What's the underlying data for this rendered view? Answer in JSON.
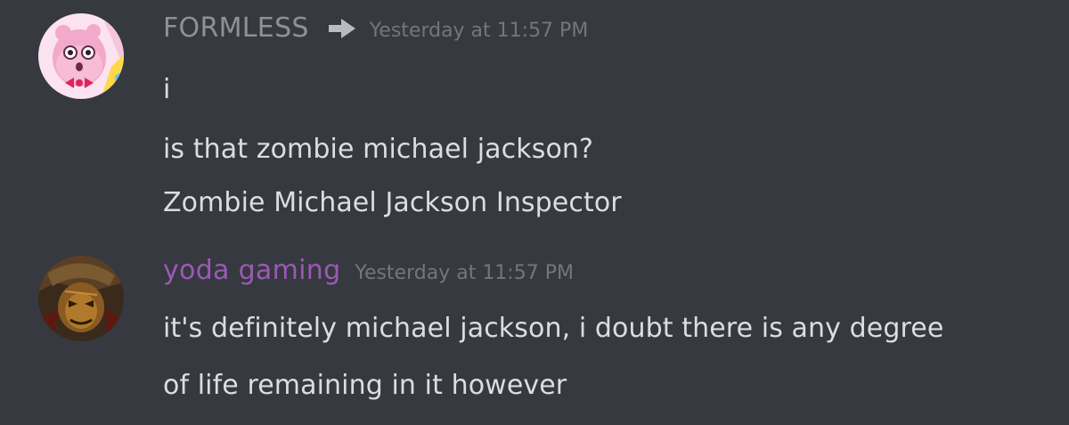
{
  "messages": [
    {
      "author": "FORMLESS",
      "author_color": "#8e9297",
      "has_reply_arrow": true,
      "arrow_icon": "arrow-right-icon",
      "timestamp": "Yesterday at 11:57 PM",
      "avatar_icon": "pink-cartoon-avatar-icon",
      "lines": [
        "i",
        "is that zombie michael jackson?",
        "Zombie Michael Jackson Inspector"
      ]
    },
    {
      "author": "yoda gaming",
      "author_color": "#9b59b6",
      "timestamp": "Yesterday at 11:57 PM",
      "avatar_icon": "dark-artwork-avatar-icon",
      "lines": [
        "it's definitely michael jackson, i doubt there is any degree",
        "of life remaining in it however"
      ]
    }
  ],
  "colors": {
    "background": "#36393f",
    "message_text": "#dcddde",
    "timestamp": "#72767d",
    "arrow": "#b9bbbe"
  }
}
